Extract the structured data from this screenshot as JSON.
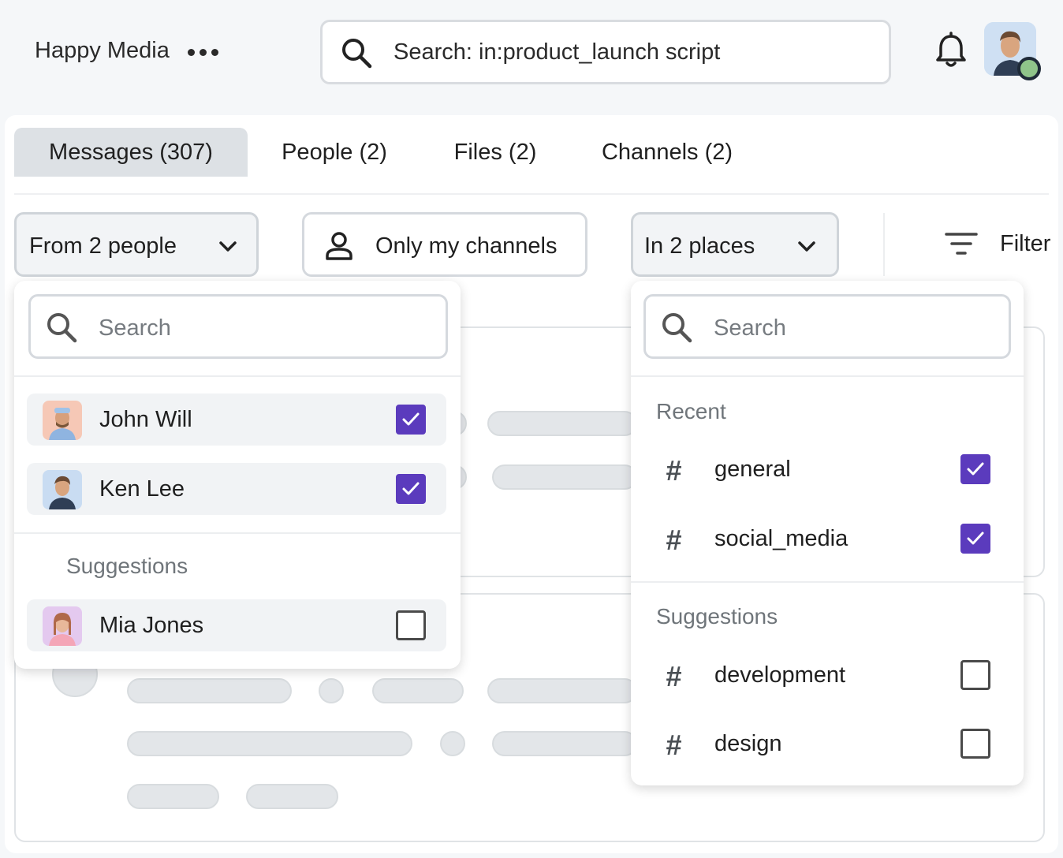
{
  "header": {
    "workspace_name": "Happy Media",
    "more_icon": "more-horizontal-icon",
    "search_value": "Search: in:product_launch script",
    "search_icon": "search-icon",
    "notifications_icon": "bell-icon",
    "profile_status_color": "#8fc48a"
  },
  "tabs": [
    {
      "label": "Messages (307)",
      "active": true
    },
    {
      "label": "People (2)",
      "active": false
    },
    {
      "label": "Files (2)",
      "active": false
    },
    {
      "label": "Channels (2)",
      "active": false
    }
  ],
  "filters": {
    "from": "From 2 people",
    "only_my_channels": "Only my channels",
    "in_places": "In 2 places",
    "filter": "Filter"
  },
  "people_dropdown": {
    "search_placeholder": "Search",
    "selected": [
      {
        "name": "John Will",
        "checked": true
      },
      {
        "name": "Ken Lee",
        "checked": true
      }
    ],
    "suggestions_label": "Suggestions",
    "suggestions": [
      {
        "name": "Mia Jones",
        "checked": false
      }
    ]
  },
  "channels_dropdown": {
    "search_placeholder": "Search",
    "recent_label": "Recent",
    "recent": [
      {
        "name": "general",
        "checked": true
      },
      {
        "name": "social_media",
        "checked": true
      }
    ],
    "suggestions_label": "Suggestions",
    "suggestions": [
      {
        "name": "development",
        "checked": false
      },
      {
        "name": "design",
        "checked": false
      }
    ]
  },
  "colors": {
    "checkbox_checked": "#5b3bbd",
    "active_tab_bg": "#dde1e5"
  }
}
